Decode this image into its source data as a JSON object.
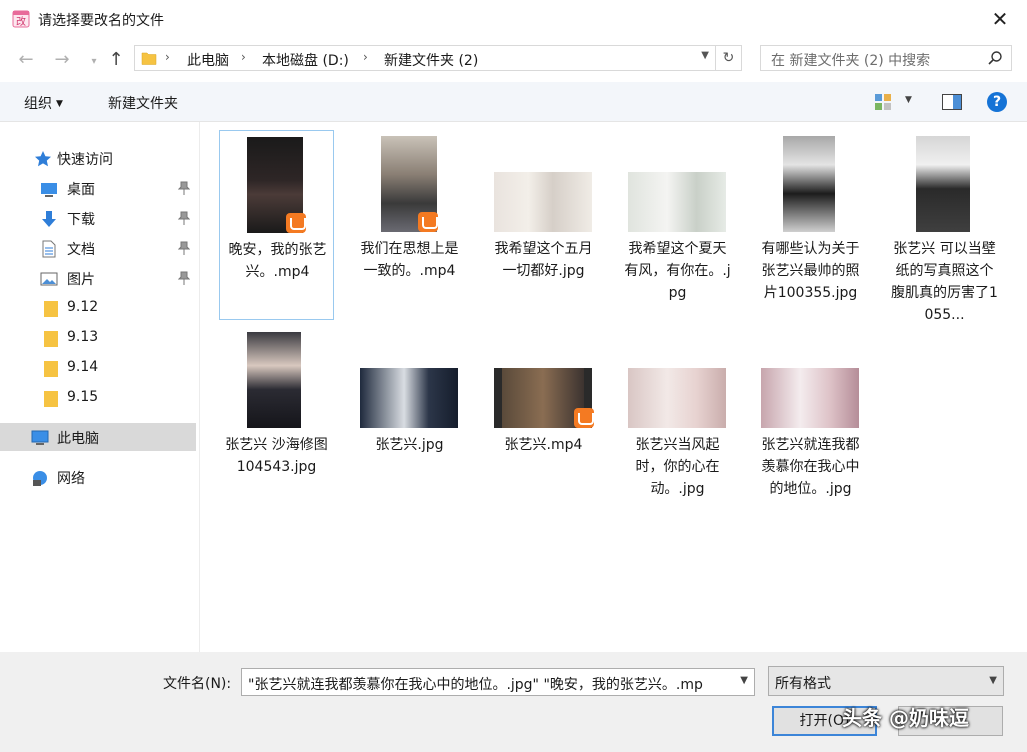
{
  "window": {
    "title": "请选择要改名的文件",
    "close_glyph": "✕"
  },
  "address": {
    "crumbs": [
      "此电脑",
      "本地磁盘 (D:)",
      "新建文件夹 (2)"
    ],
    "search_placeholder": "在 新建文件夹 (2) 中搜索"
  },
  "toolbar": {
    "organize": "组织",
    "new_folder": "新建文件夹"
  },
  "sidebar": {
    "items": [
      {
        "label": "快速访问",
        "icon": "star-icon"
      },
      {
        "label": "桌面",
        "icon": "desktop-icon",
        "pinned": true
      },
      {
        "label": "下载",
        "icon": "download-icon",
        "pinned": true
      },
      {
        "label": "文档",
        "icon": "document-icon",
        "pinned": true
      },
      {
        "label": "图片",
        "icon": "picture-icon",
        "pinned": true
      },
      {
        "label": "9.12",
        "icon": "folder-icon"
      },
      {
        "label": "9.13",
        "icon": "folder-icon"
      },
      {
        "label": "9.14",
        "icon": "folder-icon"
      },
      {
        "label": "9.15",
        "icon": "folder-icon"
      },
      {
        "label": "此电脑",
        "icon": "computer-icon",
        "selected": true
      },
      {
        "label": "网络",
        "icon": "network-icon"
      }
    ]
  },
  "files": [
    {
      "name": "晚安，我的张艺兴。.mp4",
      "type": "video",
      "selected": true
    },
    {
      "name": "我们在思想上是一致的。.mp4",
      "type": "video"
    },
    {
      "name": "我希望这个五月一切都好.jpg",
      "type": "image"
    },
    {
      "name": "我希望这个夏天有风，有你在。.jpg",
      "type": "image"
    },
    {
      "name": "有哪些认为关于张艺兴最帅的照片100355.jpg",
      "type": "image"
    },
    {
      "name": "张艺兴 可以当壁纸的写真照这个腹肌真的厉害了1055...",
      "type": "image"
    },
    {
      "name": "张艺兴 沙海修图104543.jpg",
      "type": "image"
    },
    {
      "name": "张艺兴.jpg",
      "type": "image"
    },
    {
      "name": "张艺兴.mp4",
      "type": "video"
    },
    {
      "name": "张艺兴当风起时，你的心在动。.jpg",
      "type": "image"
    },
    {
      "name": "张艺兴就连我都羡慕你在我心中的地位。.jpg",
      "type": "image"
    }
  ],
  "footer": {
    "filename_label": "文件名(N):",
    "filename_value": "\"张艺兴就连我都羡慕你在我心中的地位。.jpg\" \"晚安，我的张艺兴。.mp",
    "filter_value": "所有格式",
    "open_label": "打开(O)",
    "watermark": "头条 @奶味逗"
  },
  "colors": {
    "accent": "#1573d6",
    "folder": "#f6c342",
    "badge": "#f47a22",
    "selection_bg": "#d9d9d9"
  }
}
